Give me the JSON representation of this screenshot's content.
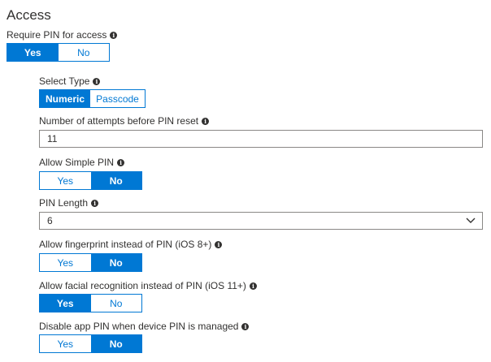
{
  "section": {
    "title": "Access"
  },
  "require_pin": {
    "label": "Require PIN for access",
    "options": [
      "Yes",
      "No"
    ],
    "selected": "Yes"
  },
  "select_type": {
    "label": "Select Type",
    "options": [
      "Numeric",
      "Passcode"
    ],
    "selected": "Numeric"
  },
  "attempts": {
    "label": "Number of attempts before PIN reset",
    "value": "11"
  },
  "simple_pin": {
    "label": "Allow Simple PIN",
    "options": [
      "Yes",
      "No"
    ],
    "selected": "No"
  },
  "pin_length": {
    "label": "PIN Length",
    "value": "6"
  },
  "fingerprint": {
    "label": "Allow fingerprint instead of PIN (iOS 8+)",
    "options": [
      "Yes",
      "No"
    ],
    "selected": "No"
  },
  "facial": {
    "label": "Allow facial recognition instead of PIN (iOS 11+)",
    "options": [
      "Yes",
      "No"
    ],
    "selected": "Yes"
  },
  "disable_app_pin": {
    "label": "Disable app PIN when device PIN is managed",
    "options": [
      "Yes",
      "No"
    ],
    "selected": "No"
  },
  "icons": {
    "info": "info-icon",
    "dropdown": "chevron-down-icon"
  },
  "colors": {
    "accent": "#0078d4",
    "text": "#323130",
    "border": "#8a8886"
  }
}
